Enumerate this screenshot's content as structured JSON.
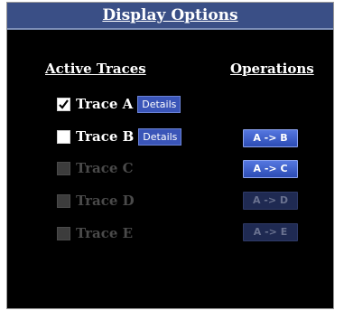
{
  "title": "Display Options",
  "headers": {
    "active_traces": "Active Traces",
    "operations": "Operations"
  },
  "traces": [
    {
      "label": "Trace A",
      "checked": true,
      "enabled": true,
      "details": "Details"
    },
    {
      "label": "Trace B",
      "checked": false,
      "enabled": true,
      "details": "Details"
    },
    {
      "label": "Trace C",
      "checked": false,
      "enabled": false
    },
    {
      "label": "Trace D",
      "checked": false,
      "enabled": false
    },
    {
      "label": "Trace E",
      "checked": false,
      "enabled": false
    }
  ],
  "operations": [
    {
      "label": "A -> B",
      "enabled": true
    },
    {
      "label": "A -> C",
      "enabled": true
    },
    {
      "label": "A -> D",
      "enabled": false
    },
    {
      "label": "A -> E",
      "enabled": false
    }
  ],
  "colors": {
    "panel_bg": "#000000",
    "title_bg": "#3a4f86",
    "button_blue": "#3a55b8",
    "disabled_text": "#4a4a4a"
  }
}
